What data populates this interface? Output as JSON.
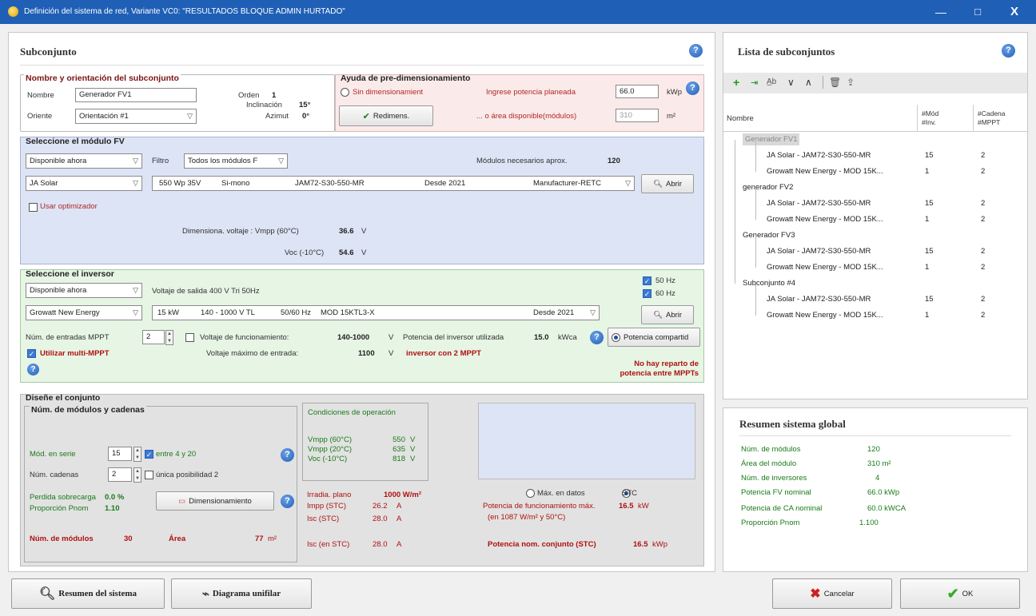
{
  "window": {
    "title": "Definición del sistema de red, Variante VC0: \"RESULTADOS BLOQUE ADMIN HURTADO\"",
    "minimize": "—",
    "maximize": "□",
    "close": "X"
  },
  "subconjunto": {
    "title": "Subconjunto",
    "name_group": {
      "title": "Nombre y orientación del subconjunto",
      "name_label": "Nombre",
      "name_value": "Generador FV1",
      "orient_label": "Oriente",
      "orient_value": "Orientación #1",
      "orden_label": "Orden",
      "orden_value": "1",
      "incl_label": "Inclinación",
      "incl_value": "15°",
      "azim_label": "Azimut",
      "azim_value": "0°"
    },
    "predim": {
      "title": "Ayuda de pre-dimensionamiento",
      "sin_label": "Sin dimensionamient",
      "potencia_label": "Ingrese potencia planeada",
      "potencia_value": "66.0",
      "potencia_unit": "kWp",
      "area_label": "... o área disponible(módulos)",
      "area_value": "310",
      "area_unit": "m²",
      "redimens_label": "Redimens."
    },
    "modulo": {
      "title": "Seleccione el módulo FV",
      "availability": "Disponible ahora",
      "filtro_label": "Filtro",
      "filtro_value": "Todos los módulos F",
      "modulos_label": "Módulos necesarios aprox.",
      "modulos_value": "120",
      "manufacturer": "JA Solar",
      "model_power": "550 Wp 35V",
      "model_tech": "Si-mono",
      "model_name": "JAM72-S30-550-MR",
      "model_since": "Desde 2021",
      "model_source": "Manufacturer-RETC",
      "abrir_label": "Abrir",
      "optimizador_label": "Usar optimizador",
      "volt_label": "Dimensiona. voltaje :  Vmpp (60°C)",
      "vmpp_value": "36.6",
      "unit_v": "V",
      "voc_label": "Voc (-10°C)",
      "voc_value": "54.6"
    },
    "inversor": {
      "title": "Seleccione el inversor",
      "availability": "Disponible ahora",
      "salida_label": "Voltaje de salida 400 V Tri 50Hz",
      "hz50": "50 Hz",
      "hz60": "60 Hz",
      "manufacturer": "Growatt New Energy",
      "model_power": "15 kW",
      "model_range": "140 - 1000 V TL",
      "model_freq": "50/60 Hz",
      "model_name": "MOD 15KTL3-X",
      "model_since": "Desde 2021",
      "abrir_label": "Abrir",
      "mppt_label": "Núm. de entradas MPPT",
      "mppt_value": "2",
      "vfunc_label": "Voltaje de funcionamiento:",
      "vfunc_value": "140-1000",
      "unit_v": "V",
      "pot_label": "Potencia del inversor utilizada",
      "pot_value": "15.0",
      "pot_unit": "kWca",
      "compartida_label": "Potencia compartid",
      "multi_label": "Utilizar multi-MPPT",
      "vmax_label": "Voltaje máximo de entrada:",
      "vmax_value": "1100",
      "con_mppt": "inversor con 2 MPPT",
      "no_reparto": "No hay reparto de",
      "no_reparto2": "potencia entre MPPTs"
    },
    "diseno": {
      "title": "Diseñe el conjunto",
      "sub_title": "Núm. de módulos y cadenas",
      "serie_label": "Mód. en serie",
      "serie_value": "15",
      "entre_label": "entre 4 y 20",
      "cadenas_label": "Núm. cadenas",
      "cadenas_value": "2",
      "unica_label": "única posibilidad 2",
      "perdida_label": "Perdida sobrecarga",
      "perdida_value": "0.0 %",
      "proporcion_label": "Proporción Pnom",
      "proporcion_value": "1.10",
      "dimens_label": "Dimensionamiento",
      "num_mod_label": "Núm. de módulos",
      "num_mod_value": "30",
      "area_label": "Área",
      "area_value": "77",
      "area_unit": "m²",
      "cond_title": "Condiciones de operación",
      "vmpp60_label": "Vmpp (60°C)",
      "vmpp60_value": "550",
      "vmpp20_label": "Vmpp (20°C)",
      "vmpp20_value": "635",
      "voc10_label": "Voc (-10°C)",
      "voc10_value": "818",
      "unit_v": "V",
      "irrad_label": "Irradia. plano",
      "irrad_value": "1000 W/m²",
      "impp_label": "Impp (STC)",
      "impp_value": "26.2",
      "isc_label": "Isc (STC)",
      "isc_value": "28.0",
      "unit_a": "A",
      "isc2_label": "Isc (en STC)",
      "isc2_value": "28.0",
      "max_datos": "Máx. en datos",
      "stc": "STC",
      "pot_max_label": "Potencia de funcionamiento máx.",
      "pot_max_value": "16.5",
      "pot_unit": "kW",
      "pot_cond": "(en 1087 W/m² y 50°C)",
      "pot_nom_label": "Potencia nom. conjunto (STC)",
      "pot_nom_value": "16.5",
      "pot_nom_unit": "kWp"
    }
  },
  "lista": {
    "title": "Lista de subconjuntos",
    "col_nombre": "Nombre",
    "col_mod1": "#Mód",
    "col_mod2": "#Inv.",
    "col_cad1": "#Cadena",
    "col_cad2": "#MPPT",
    "rows": [
      {
        "name": "Generador FV1",
        "mod": "",
        "cad": "",
        "level": 0,
        "sel": true
      },
      {
        "name": "JA Solar - JAM72-S30-550-MR",
        "mod": "15",
        "cad": "2",
        "level": 1
      },
      {
        "name": "Growatt New Energy - MOD 15K...",
        "mod": "1",
        "cad": "2",
        "level": 1
      },
      {
        "name": "generador FV2",
        "mod": "",
        "cad": "",
        "level": 0
      },
      {
        "name": "JA Solar - JAM72-S30-550-MR",
        "mod": "15",
        "cad": "2",
        "level": 1
      },
      {
        "name": "Growatt New Energy - MOD 15K...",
        "mod": "1",
        "cad": "2",
        "level": 1
      },
      {
        "name": "Generador FV3",
        "mod": "",
        "cad": "",
        "level": 0
      },
      {
        "name": "JA Solar - JAM72-S30-550-MR",
        "mod": "15",
        "cad": "2",
        "level": 1
      },
      {
        "name": "Growatt New Energy - MOD 15K...",
        "mod": "1",
        "cad": "2",
        "level": 1
      },
      {
        "name": "Subconjunto #4",
        "mod": "",
        "cad": "",
        "level": 0
      },
      {
        "name": "JA Solar - JAM72-S30-550-MR",
        "mod": "15",
        "cad": "2",
        "level": 1
      },
      {
        "name": "Growatt New Energy - MOD 15K...",
        "mod": "1",
        "cad": "2",
        "level": 1
      }
    ]
  },
  "resumen": {
    "title": "Resumen sistema global",
    "rows": [
      {
        "label": "Núm. de módulos",
        "value": "120"
      },
      {
        "label": "Área del módulo",
        "value": "310 m²"
      },
      {
        "label": "Núm. de inversores",
        "value": "4"
      },
      {
        "label": "Potencia FV nominal",
        "value": "66.0 kWp"
      },
      {
        "label": "Potencia de CA nominal",
        "value": "60.0 kWCA"
      },
      {
        "label": "Proporción Pnom",
        "value": "1.100"
      }
    ]
  },
  "footer": {
    "resumen_label": "Resumen del sistema",
    "diagrama_label": "Diagrama unifilar",
    "cancelar_label": "Cancelar",
    "ok_label": "OK"
  },
  "colors": {
    "titlebar": "#1f5fb6",
    "predim_bg": "#fbeaea",
    "modulo_bg": "#dde4f5",
    "inversor_bg": "#e6f5e4",
    "diseno_bg": "#e2e2e2"
  }
}
